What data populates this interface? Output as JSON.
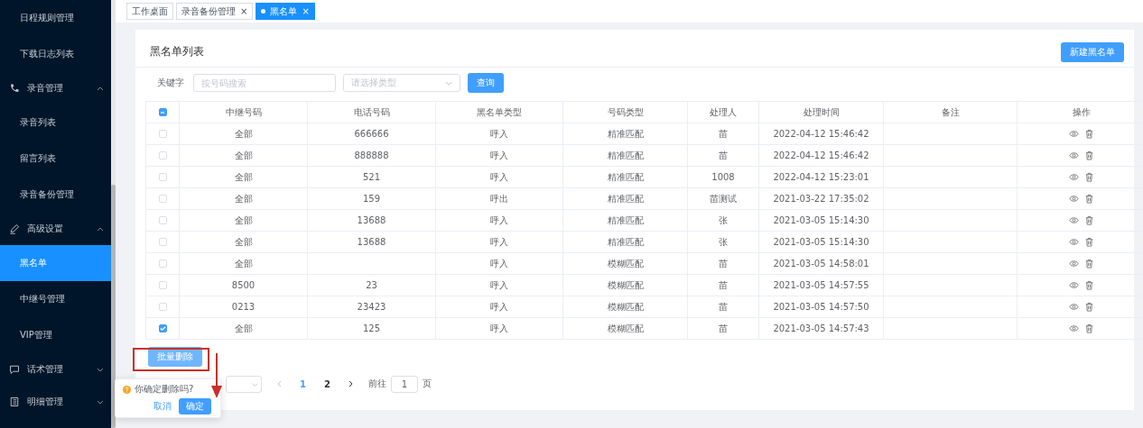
{
  "sidebar": {
    "items": [
      {
        "kind": "item",
        "label": "日程规则管理",
        "selected": false
      },
      {
        "kind": "item",
        "label": "下载日志列表",
        "selected": false
      },
      {
        "kind": "group",
        "label": "录音管理",
        "expanded": true
      },
      {
        "kind": "item",
        "label": "录音列表",
        "selected": false
      },
      {
        "kind": "item",
        "label": "留言列表",
        "selected": false
      },
      {
        "kind": "item",
        "label": "录音备份管理",
        "selected": false
      },
      {
        "kind": "group",
        "label": "高级设置",
        "expanded": true
      },
      {
        "kind": "item",
        "label": "黑名单",
        "selected": true
      },
      {
        "kind": "item",
        "label": "中继号管理",
        "selected": false
      },
      {
        "kind": "item",
        "label": "VIP管理",
        "selected": false
      },
      {
        "kind": "group",
        "label": "话术管理",
        "expanded": false
      },
      {
        "kind": "group",
        "label": "明细管理",
        "expanded": false
      }
    ]
  },
  "tabs": [
    {
      "label": "工作桌面",
      "selected": false,
      "closable": false
    },
    {
      "label": "录音备份管理",
      "selected": false,
      "closable": true,
      "close": "×"
    },
    {
      "label": "黑名单",
      "selected": true,
      "closable": true,
      "close": "×"
    }
  ],
  "card": {
    "title": "黑名单列表",
    "new_button": "新建黑名单"
  },
  "filter": {
    "label": "关键字",
    "search": {
      "placeholder": "按号码搜索"
    },
    "type_select": {
      "placeholder": "请选择类型"
    },
    "query_button": "查询"
  },
  "table": {
    "select_all_indeterminate": true,
    "columns": [
      "中继号码",
      "电话号码",
      "黑名单类型",
      "号码类型",
      "处理人",
      "处理时间",
      "备注",
      "操作"
    ],
    "rows": [
      {
        "checked": false,
        "cells": [
          "全部",
          "666666",
          "呼入",
          "精准匹配",
          "苗",
          "2022-04-12 15:46:42",
          ""
        ]
      },
      {
        "checked": false,
        "cells": [
          "全部",
          "888888",
          "呼入",
          "精准匹配",
          "苗",
          "2022-04-12 15:46:42",
          ""
        ]
      },
      {
        "checked": false,
        "cells": [
          "全部",
          "521",
          "呼入",
          "精准匹配",
          "1008",
          "2022-04-12 15:23:01",
          ""
        ]
      },
      {
        "checked": false,
        "cells": [
          "全部",
          "159",
          "呼出",
          "精准匹配",
          "苗测试",
          "2021-03-22 17:35:02",
          ""
        ]
      },
      {
        "checked": false,
        "cells": [
          "全部",
          "13688",
          "呼入",
          "精准匹配",
          "张",
          "2021-03-05 15:14:30",
          ""
        ]
      },
      {
        "checked": false,
        "cells": [
          "全部",
          "13688",
          "呼入",
          "精准匹配",
          "张",
          "2021-03-05 15:14:30",
          ""
        ]
      },
      {
        "checked": false,
        "cells": [
          "全部",
          "",
          "呼入",
          "模糊匹配",
          "苗",
          "2021-03-05 14:58:01",
          ""
        ]
      },
      {
        "checked": false,
        "cells": [
          "8500",
          "23",
          "呼入",
          "模糊匹配",
          "苗",
          "2021-03-05 14:57:55",
          ""
        ]
      },
      {
        "checked": false,
        "cells": [
          "0213",
          "23423",
          "呼入",
          "模糊匹配",
          "苗",
          "2021-03-05 14:57:50",
          ""
        ]
      },
      {
        "checked": true,
        "cells": [
          "全部",
          "125",
          "呼入",
          "模糊匹配",
          "苗",
          "2021-03-05 14:57:43",
          ""
        ]
      }
    ]
  },
  "batch_delete_button": "批量删除",
  "pagination": {
    "pages": [
      {
        "label": "1",
        "selected": true
      },
      {
        "label": "2",
        "selected": false
      }
    ],
    "prev_disabled": true,
    "goto_label": "前往",
    "goto_value": "1",
    "page_suffix": "页"
  },
  "popconfirm": {
    "message": "你确定删除吗?",
    "cancel": "取消",
    "confirm": "确定"
  }
}
